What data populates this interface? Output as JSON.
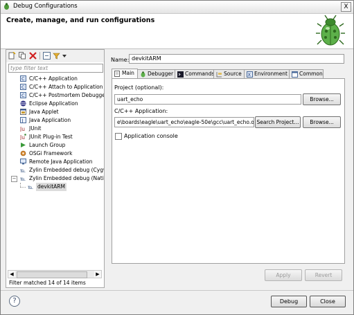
{
  "window": {
    "title": "Debug Configurations",
    "close_glyph": "X"
  },
  "banner": {
    "title": "Create, manage, and run configurations",
    "icon": "bug-icon"
  },
  "left_pane": {
    "toolbar_icons": [
      "new-config-icon",
      "duplicate-icon",
      "delete-icon",
      "collapse-all-icon",
      "filter-icon",
      "dropdown-icon"
    ],
    "filter_placeholder": "type filter text",
    "tree": [
      {
        "label": "C/C++ Application",
        "icon": "c-config-icon"
      },
      {
        "label": "C/C++ Attach to Application",
        "icon": "c-config-icon"
      },
      {
        "label": "C/C++ Postmortem Debugger",
        "icon": "c-config-icon"
      },
      {
        "label": "Eclipse Application",
        "icon": "eclipse-icon"
      },
      {
        "label": "Java Applet",
        "icon": "java-applet-icon"
      },
      {
        "label": "Java Application",
        "icon": "java-app-icon"
      },
      {
        "label": "JUnit",
        "icon": "junit-icon"
      },
      {
        "label": "JUnit Plug-in Test",
        "icon": "junit-plugin-icon"
      },
      {
        "label": "Launch Group",
        "icon": "launch-group-icon"
      },
      {
        "label": "OSGi Framework",
        "icon": "osgi-icon"
      },
      {
        "label": "Remote Java Application",
        "icon": "remote-java-icon"
      },
      {
        "label": "Zylin Embedded debug (Cygwin",
        "icon": "zylin-icon"
      },
      {
        "label": "Zylin Embedded debug (Native",
        "icon": "zylin-icon",
        "expanded": true
      },
      {
        "label": "devkitARM",
        "icon": "zylin-icon",
        "child": true,
        "selected": true
      }
    ],
    "expander_glyph": "−",
    "scroll_left": "◀",
    "scroll_right": "▶",
    "filter_status": "Filter matched 14 of 14 items"
  },
  "right_pane": {
    "name_label": "Name:",
    "name_value": "devkitARM",
    "tabs": [
      {
        "label": "Main",
        "icon": "main-tab-icon",
        "active": true
      },
      {
        "label": "Debugger",
        "icon": "debugger-tab-icon"
      },
      {
        "label": "Commands",
        "icon": "commands-tab-icon"
      },
      {
        "label": "Source",
        "icon": "source-tab-icon"
      },
      {
        "label": "Environment",
        "icon": "environment-tab-icon"
      },
      {
        "label": "Common",
        "icon": "common-tab-icon"
      }
    ],
    "project_label": "Project (optional):",
    "project_value": "uart_echo",
    "browse_label": "Browse...",
    "app_label": "C/C++ Application:",
    "app_value": "e\\boards\\eagle\\uart_echo\\eagle-50e\\gcc\\uart_echo.out",
    "search_project_label": "Search Project...",
    "console_label": "Application console",
    "apply_label": "Apply",
    "revert_label": "Revert"
  },
  "footer": {
    "help_glyph": "?",
    "debug_label": "Debug",
    "close_label": "Close"
  }
}
